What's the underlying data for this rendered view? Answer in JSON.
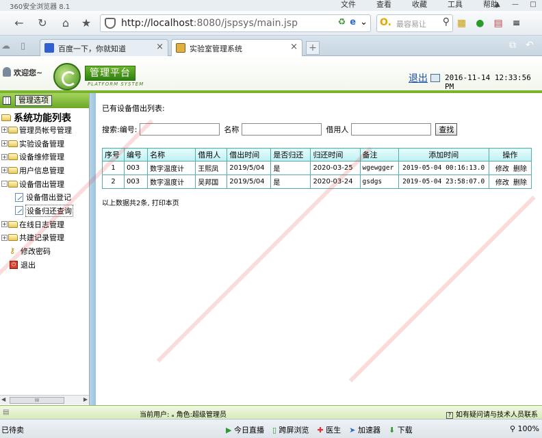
{
  "browser": {
    "app_title": "360安全浏览器 8.1",
    "menu": [
      "文件",
      "查看",
      "收藏",
      "工具",
      "帮助"
    ],
    "url_host": "http://localhost",
    "url_rest": ":8080/jspsys/main.jsp",
    "search_placeholder": "最容易让",
    "tabs": [
      {
        "label": "百度一下，你就知道",
        "active": false
      },
      {
        "label": "实验室管理系统",
        "active": true
      }
    ],
    "icons": [
      "back-icon",
      "refresh-icon",
      "home-icon",
      "star-icon",
      "shield-icon"
    ]
  },
  "header": {
    "welcome": "欢迎您~",
    "logo_text": "管理平台",
    "logo_sub": "PLATFORM SYSTEM",
    "logout": "退出",
    "datetime": "2016-11-14 12:33:56 PM",
    "accent": "#7ab32e"
  },
  "sidebar": {
    "head_label": "管理选项",
    "root": "系统功能列表",
    "items": [
      {
        "label": "管理员帐号管理",
        "type": "folder",
        "sign": "+"
      },
      {
        "label": "实验设备管理",
        "type": "folder",
        "sign": "+"
      },
      {
        "label": "设备维修管理",
        "type": "folder",
        "sign": "+"
      },
      {
        "label": "用户信息管理",
        "type": "folder",
        "sign": "+"
      },
      {
        "label": "设备借出管理",
        "type": "folder",
        "sign": "-"
      },
      {
        "label": "设备借出登记",
        "type": "doc"
      },
      {
        "label": "设备归还查询",
        "type": "doc",
        "selected": true
      },
      {
        "label": "在线日志管理",
        "type": "folder",
        "sign": "+"
      },
      {
        "label": "共建记录管理",
        "type": "folder",
        "sign": "+"
      },
      {
        "label": "修改密码",
        "type": "key"
      },
      {
        "label": "退出",
        "type": "exit"
      }
    ],
    "scroll_thumb": "III"
  },
  "main": {
    "heading": "已有设备借出列表:",
    "search": {
      "label_bianhao": "搜索:编号:",
      "label_mingcheng": "名称",
      "label_jieyongren": "借用人",
      "button": "查找",
      "bianhao": "",
      "mingcheng": "",
      "jieyongren": ""
    },
    "columns": [
      "序号",
      "编号",
      "名称",
      "借用人",
      "借出时间",
      "是否归还",
      "归还时间",
      "备注",
      "添加时间",
      "操作"
    ],
    "rows": [
      {
        "seq": "1",
        "code": "003",
        "name": "数字温度计",
        "borrower": "王熙凤",
        "lend_date": "2019/5/04",
        "returned": "是",
        "return_date": "2020-03-25",
        "note": "wgewgger",
        "added": "2019-05-04 00:16:13.0",
        "edit": "修改",
        "del": "删除"
      },
      {
        "seq": "2",
        "code": "003",
        "name": "数字温度计",
        "borrower": "吴邦国",
        "lend_date": "2019/5/04",
        "returned": "是",
        "return_date": "2020-03-24",
        "note": "gsdgs",
        "added": "2019-05-04 23:58:07.0",
        "edit": "修改",
        "del": "删除"
      }
    ],
    "summary": "以上数据共2条, 打印本页"
  },
  "status": {
    "current_user": "当前用户: ₐ  角色:超级管理员",
    "help": "如有疑问请与技术人员联系",
    "ready": "已待卖",
    "items": [
      "今日直播",
      "跨屏浏览",
      "医生",
      "加速器",
      "下载"
    ],
    "zoom": "100%"
  }
}
